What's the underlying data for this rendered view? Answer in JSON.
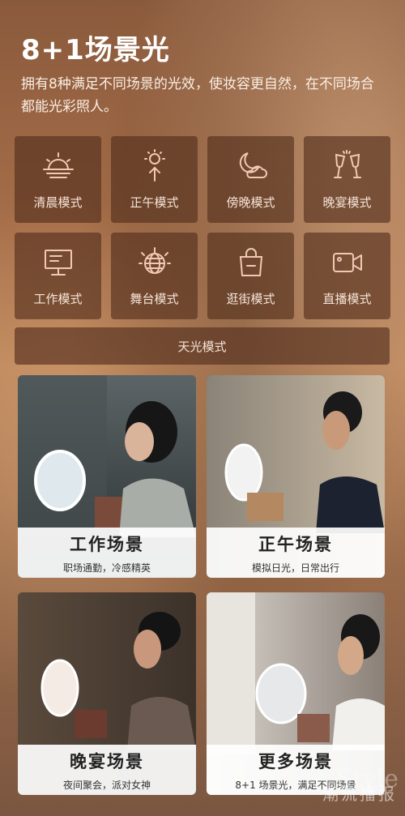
{
  "header": {
    "title": "8+1场景光",
    "description": "拥有8种满足不同场景的光效，使妆容更自然，在不同场合都能光彩照人。"
  },
  "modes": [
    {
      "label": "清晨模式",
      "icon": "sunrise-icon"
    },
    {
      "label": "正午模式",
      "icon": "sun-up-icon"
    },
    {
      "label": "傍晚模式",
      "icon": "moon-cloud-icon"
    },
    {
      "label": "晚宴模式",
      "icon": "champagne-icon"
    },
    {
      "label": "工作模式",
      "icon": "monitor-icon"
    },
    {
      "label": "舞台模式",
      "icon": "disco-ball-icon"
    },
    {
      "label": "逛街模式",
      "icon": "shopping-bag-icon"
    },
    {
      "label": "直播模式",
      "icon": "video-camera-icon"
    }
  ],
  "wide_mode": {
    "label": "天光模式"
  },
  "scenes": [
    {
      "title": "工作场景",
      "subtitle": "职场通勤，冷感精英"
    },
    {
      "title": "正午场景",
      "subtitle": "模拟日光，日常出行"
    },
    {
      "title": "晚宴场景",
      "subtitle": "夜间聚会，派对女神"
    },
    {
      "title": "更多场景",
      "subtitle": "8+1 场景光，满足不同场景"
    }
  ],
  "watermark": {
    "text": "潮流播报",
    "brand": "Style"
  }
}
